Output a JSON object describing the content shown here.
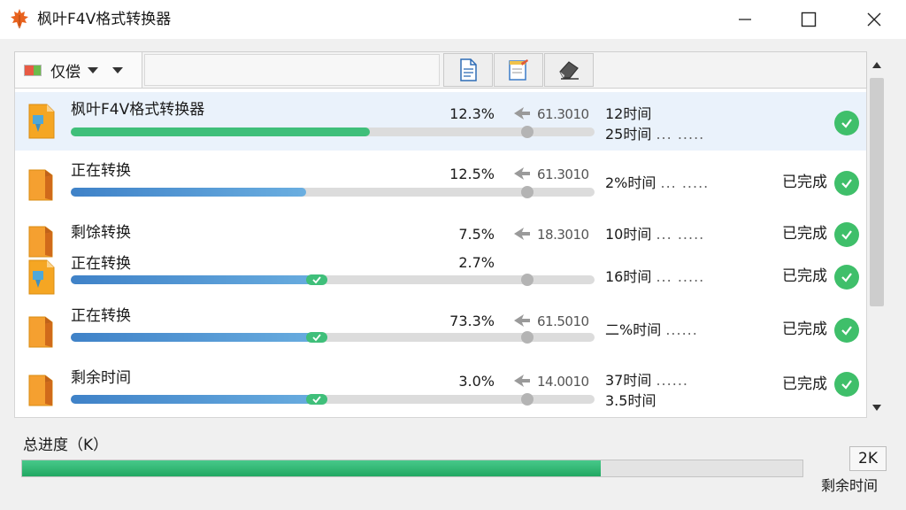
{
  "window": {
    "title": "枫叶F4V格式转换器",
    "app_icon": "maple-leaf-icon",
    "controls": [
      "minimize-icon",
      "maximize-icon",
      "close-icon"
    ]
  },
  "toolbar": {
    "filter_label": "仅偿",
    "filter_flag_colors": [
      "#e85a44",
      "#6cbb4b"
    ],
    "buttons": [
      {
        "name": "document-icon"
      },
      {
        "name": "notepad-icon"
      },
      {
        "name": "eraser-icon"
      }
    ]
  },
  "rows": [
    {
      "name": "枫叶F4V格式转换器",
      "progress": 0.57,
      "bar_color": "#3fbf7a",
      "percent": "12.3%",
      "speed": "61.3010",
      "time1": "12时间",
      "time2": "25时间",
      "time2_dots": "... .....",
      "status": "",
      "selected": true,
      "mini_check": false
    },
    {
      "name": "正在转换",
      "progress": 0.45,
      "bar_color": "#4a90d9",
      "percent": "12.5%",
      "speed": "61.3010",
      "time1": "2%时间",
      "time1_dots": "... .....",
      "status": "已完成",
      "selected": false,
      "mini_check": false
    },
    {
      "name": "剩馀转换",
      "progress": 0,
      "bar_color": "#4a90d9",
      "percent": "7.5%",
      "speed": "18.3010",
      "time1": "10时间",
      "time1_dots": "... .....",
      "status": "已完成",
      "selected": false,
      "mini_check": false
    },
    {
      "name": "正在转换",
      "progress": 0.49,
      "bar_color": "#4a90d9",
      "percent": "2.7%",
      "speed": "",
      "time1": "16时间",
      "time1_dots": "... .....",
      "status": "已完成",
      "selected": false,
      "mini_check": true
    },
    {
      "name": "正在转换",
      "progress": 0.49,
      "bar_color": "#4a90d9",
      "percent": "73.3%",
      "speed": "61.5010",
      "time1": "二%时间",
      "time1_dots": "......",
      "status": "已完成",
      "selected": false,
      "mini_check": true
    },
    {
      "name": "剩余时间",
      "progress": 0.49,
      "bar_color": "#4a90d9",
      "percent": "3.0%",
      "speed": "14.0010",
      "time1": "37时间",
      "time1_dots": "......",
      "time2": "3.5时间",
      "status": "已完成",
      "selected": false,
      "mini_check": true
    }
  ],
  "footer": {
    "total_label": "总进度（K）",
    "total_progress": 0.74,
    "count": "2K",
    "remaining_label": "剩余时间"
  },
  "colors": {
    "accent_green": "#3fbf6a",
    "selected_row": "#eaf2fb"
  }
}
